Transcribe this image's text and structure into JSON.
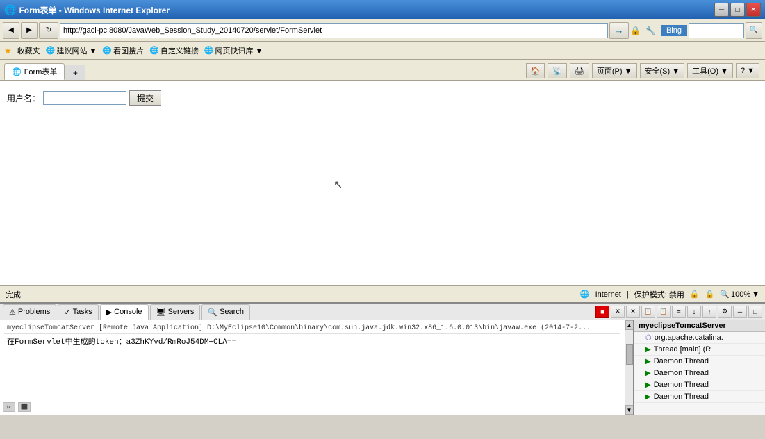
{
  "titleBar": {
    "title": "Form表单 - Windows Internet Explorer",
    "icon": "🌐",
    "buttons": {
      "minimize": "─",
      "maximize": "□",
      "close": "✕"
    }
  },
  "addressBar": {
    "backBtn": "◀",
    "forwardBtn": "▶",
    "refreshBtn": "↻",
    "stopBtn": "✕",
    "url": "http://gacl-pc:8080/JavaWeb_Session_Study_20140720/servlet/FormServlet",
    "bingLabel": "Bing",
    "searchIcon": "🔍"
  },
  "favoritesBar": {
    "starLabel": "收藏夹",
    "items": [
      {
        "icon": "🌐",
        "label": "建议网站 ▼"
      },
      {
        "icon": "🌐",
        "label": "看图搜片"
      },
      {
        "icon": "🌐",
        "label": "自定义链接"
      },
      {
        "icon": "🌐",
        "label": "网页快讯库 ▼"
      }
    ]
  },
  "tab": {
    "label": "Form表单",
    "icon": "🌐"
  },
  "toolbar": {
    "homeBtn": "🏠",
    "feedBtn": "📡",
    "printBtn": "🖨",
    "pageBtn": "页面(P) ▼",
    "safeBtn": "安全(S) ▼",
    "toolsBtn": "工具(O) ▼",
    "helpBtn": "? ▼"
  },
  "browserContent": {
    "formLabel": "用户名：",
    "submitBtn": "提交",
    "inputPlaceholder": ""
  },
  "statusBar": {
    "status": "完成",
    "internet": "Internet",
    "protection": "保护模式: 禁用",
    "zoom": "100%",
    "zoomIcon": "🔍"
  },
  "idePanel": {
    "tabs": [
      {
        "label": "Problems",
        "icon": "⚠"
      },
      {
        "label": "Tasks",
        "icon": "✓"
      },
      {
        "label": "Console",
        "icon": "▶",
        "active": true
      },
      {
        "label": "Servers",
        "icon": "🖥"
      },
      {
        "label": "Search",
        "icon": "🔍"
      }
    ],
    "consoleTitle": "myeclipseTomcatServer [Remote Java Application] D:\\MyEclipse10\\Common\\binary\\com.sun.java.jdk.win32.x86_1.6.0.013\\bin\\javaw.exe (2014-7-2...",
    "tokenLine": "在FormServlet中生成的token：a3ZhKYvd/RmRoJ54DM+CLA==",
    "rightPanel": {
      "header": "myeclipseTomcatServer",
      "threads": [
        {
          "label": "org.apache.catalina.",
          "type": "package"
        },
        {
          "label": "Thread [main] (R",
          "type": "thread-main"
        },
        {
          "label": "Daemon Thread",
          "type": "daemon"
        },
        {
          "label": "Daemon Thread",
          "type": "daemon"
        },
        {
          "label": "Daemon Thread",
          "type": "daemon"
        },
        {
          "label": "Daemon Thread",
          "type": "daemon"
        }
      ]
    }
  }
}
